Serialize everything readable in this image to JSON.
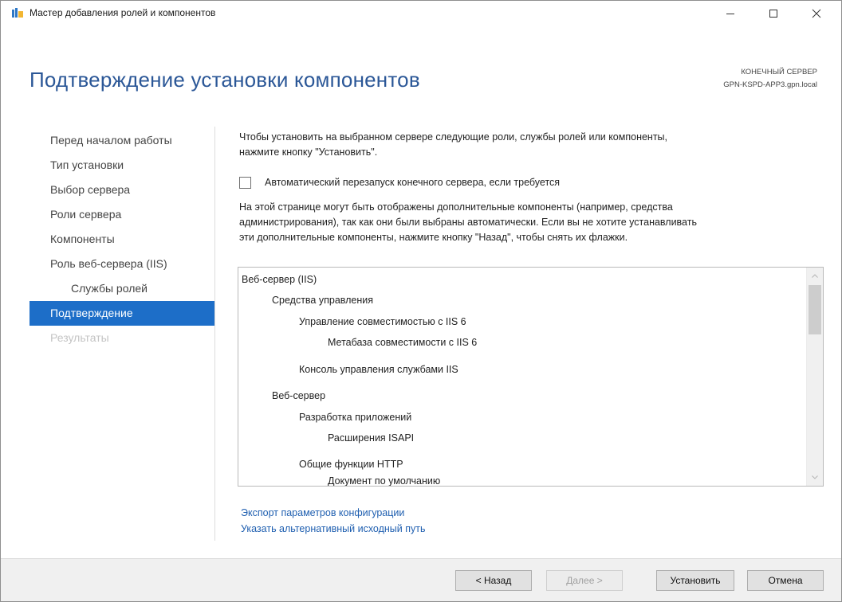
{
  "window": {
    "title": "Мастер добавления ролей и компонентов"
  },
  "header": {
    "page_title": "Подтверждение установки компонентов",
    "destination_label": "КОНЕЧНЫЙ СЕРВЕР",
    "destination_server": "GPN-KSPD-APP3.gpn.local"
  },
  "nav": {
    "items": [
      {
        "label": "Перед началом работы",
        "state": "normal"
      },
      {
        "label": "Тип установки",
        "state": "normal"
      },
      {
        "label": "Выбор сервера",
        "state": "normal"
      },
      {
        "label": "Роли сервера",
        "state": "normal"
      },
      {
        "label": "Компоненты",
        "state": "normal"
      },
      {
        "label": "Роль веб-сервера (IIS)",
        "state": "normal"
      },
      {
        "label": "Службы ролей",
        "state": "sub"
      },
      {
        "label": "Подтверждение",
        "state": "active"
      },
      {
        "label": "Результаты",
        "state": "disabled"
      }
    ]
  },
  "main": {
    "intro_line1": "Чтобы установить на выбранном сервере следующие роли, службы ролей или компоненты,",
    "intro_line2": "нажмите кнопку \"Установить\".",
    "restart_checkbox": {
      "label": "Автоматический перезапуск конечного сервера, если требуется",
      "checked": false
    },
    "note_line1": "На этой странице могут быть отображены дополнительные компоненты (например, средства",
    "note_line2": "администрирования), так как они были выбраны автоматически. Если вы не хотите устанавливать",
    "note_line3": "эти дополнительные компоненты, нажмите кнопку \"Назад\", чтобы снять их флажки.",
    "tree_items": [
      {
        "label": "Веб-сервер (IIS)",
        "level": 0
      },
      {
        "label": "Средства управления",
        "level": 1
      },
      {
        "label": "Управление совместимостью с IIS 6",
        "level": 2
      },
      {
        "label": "Метабаза совместимости с IIS 6",
        "level": 3
      },
      {
        "label": "Консоль управления службами IIS",
        "level": 2
      },
      {
        "label": "Веб-сервер",
        "level": 1
      },
      {
        "label": "Разработка приложений",
        "level": 2
      },
      {
        "label": "Расширения ISAPI",
        "level": 3
      },
      {
        "label": "Общие функции HTTP",
        "level": 2
      },
      {
        "label": "Документ по умолчанию",
        "level": 3
      }
    ],
    "links": {
      "export": "Экспорт параметров конфигурации",
      "alt_path": "Указать альтернативный исходный путь"
    }
  },
  "footer": {
    "back_label": "< Назад",
    "next_label": "Далее >",
    "install_label": "Установить",
    "cancel_label": "Отмена"
  },
  "colors": {
    "accent": "#1d6ec8",
    "title": "#2b5797",
    "link": "#1f5fb0",
    "disabled_text": "#c4c4c4"
  },
  "icons": {
    "app": "server-manager-icon",
    "minimize": "minimize-icon",
    "maximize": "maximize-icon",
    "close": "close-icon",
    "scroll_up": "chevron-up-icon",
    "scroll_down": "chevron-down-icon"
  }
}
